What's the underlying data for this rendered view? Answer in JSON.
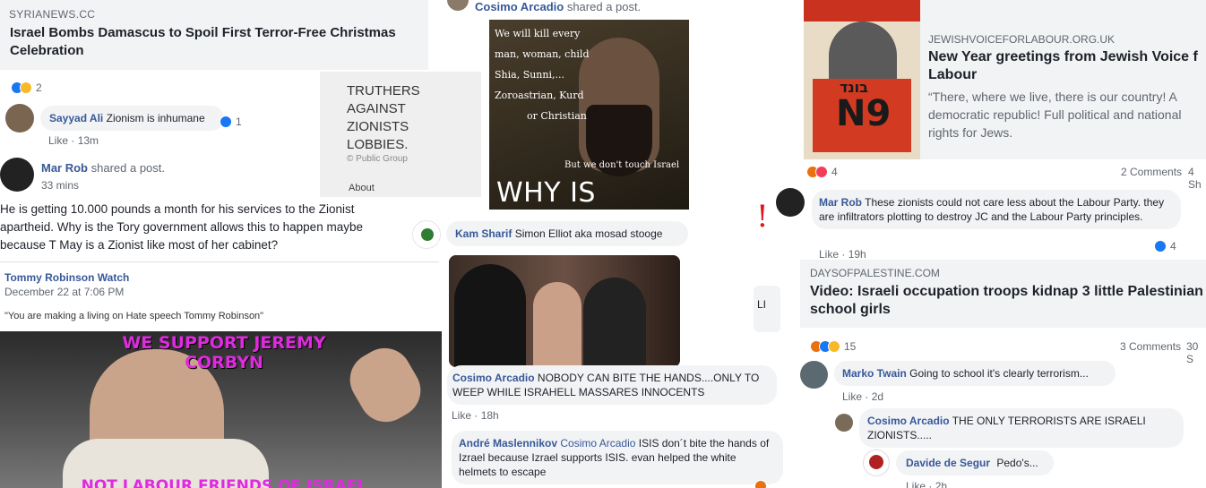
{
  "col1": {
    "link1": {
      "domain": "SYRIANEWS.CC",
      "title": "Israel Bombs Damascus to Spoil First Terror-Free Christmas Celebration",
      "reaction_count": "2"
    },
    "group_card": {
      "name": "TRUTHERS AGAINST ZIONISTS LOBBIES.",
      "type": "Public Group",
      "about": "About"
    },
    "comment1": {
      "author": "Sayyad Ali",
      "text": "Zionism is inhumane",
      "like_count": "1",
      "action": "Like",
      "time": "13m"
    },
    "share1": {
      "author": "Mar Rob",
      "action": "shared a post.",
      "time": "33 mins",
      "text": "He is getting 10.000 pounds a month for his services to the Zionist apartheid. Why is the Tory government allows this to happen maybe because T May is a Zionist like most of her cabinet?"
    },
    "shared_post": {
      "author": "Tommy Robinson Watch",
      "date": "December 22 at 7:06 PM",
      "quote": "\"You are making a living on Hate speech Tommy Robinson\""
    },
    "meme_bottom": {
      "top_text": "WE SUPPORT JEREMY CORBYN",
      "bottom_text": "NOT LABOUR FRIENDS OF ISRAEL"
    }
  },
  "col2": {
    "share_header": {
      "author": "Cosimo Arcadio",
      "action": "shared a post."
    },
    "meme_top": {
      "lines": [
        "We will kill every",
        "man, woman, child",
        "Shia, Sunni,...",
        "Zoroastrian, Kurd",
        "or Christian"
      ],
      "bottom_line": "But we don't touch Israel",
      "caption": "WHY IS THAT?"
    },
    "exclamation": "!",
    "comment_kam": {
      "author": "Kam Sharif",
      "text": "Simon Elliot aka mosad stooge"
    },
    "partial_letters": "LI",
    "comment_cosimo": {
      "author": "Cosimo Arcadio",
      "text": "NOBODY CAN BITE THE HANDS....ONLY TO WEEP WHILE ISRAHELL MASSARES INNOCENTS",
      "action": "Like",
      "time": "18h"
    },
    "comment_andre": {
      "author": "André Maslennikov",
      "mention": "Cosimo Arcadio",
      "text": "ISIS don´t bite the hands of Izrael because Izrael supports ISIS. evan helped the white helmets to escape"
    }
  },
  "col3": {
    "link_jvl": {
      "domain": "JEWISHVOICEFORLABOUR.ORG.UK",
      "title": "New Year greetings from Jewish Voice f Labour",
      "desc": "“There, where we live, there is our country! A democratic republic! Full political and national rights for Jews.",
      "reaction_count": "4",
      "comments": "2 Comments",
      "shares": "4 Sh"
    },
    "poster": {
      "number": "N9",
      "hebrew": "בונד"
    },
    "comment_marrob": {
      "author": "Mar Rob",
      "text": "These zionists could not care less about the Labour Party. they are infiltrators plotting to destroy JC and the Labour Party principles.",
      "like_count": "4",
      "action": "Like",
      "time": "19h"
    },
    "link_dop": {
      "domain": "DAYSOFPALESTINE.COM",
      "title": "Video: Israeli occupation troops kidnap 3 little Palestinian school girls",
      "reaction_count": "15",
      "comments": "3 Comments",
      "shares": "30 S"
    },
    "comment_marko": {
      "author": "Marko Twain",
      "text": "Going to school it's clearly terrorism...",
      "action": "Like",
      "time": "2d"
    },
    "comment_cosimo2": {
      "author": "Cosimo Arcadio",
      "text": "THE ONLY TERRORISTS ARE ISRAELI ZIONISTS....."
    },
    "comment_davide": {
      "author": "Davide de Segur",
      "text": "Pedo's...",
      "action": "Like",
      "time": "2h"
    }
  },
  "colors": {
    "link": "#385898",
    "grey": "#f2f3f5",
    "like": "#1877f2",
    "meme_magenta": "#d62ad6"
  }
}
